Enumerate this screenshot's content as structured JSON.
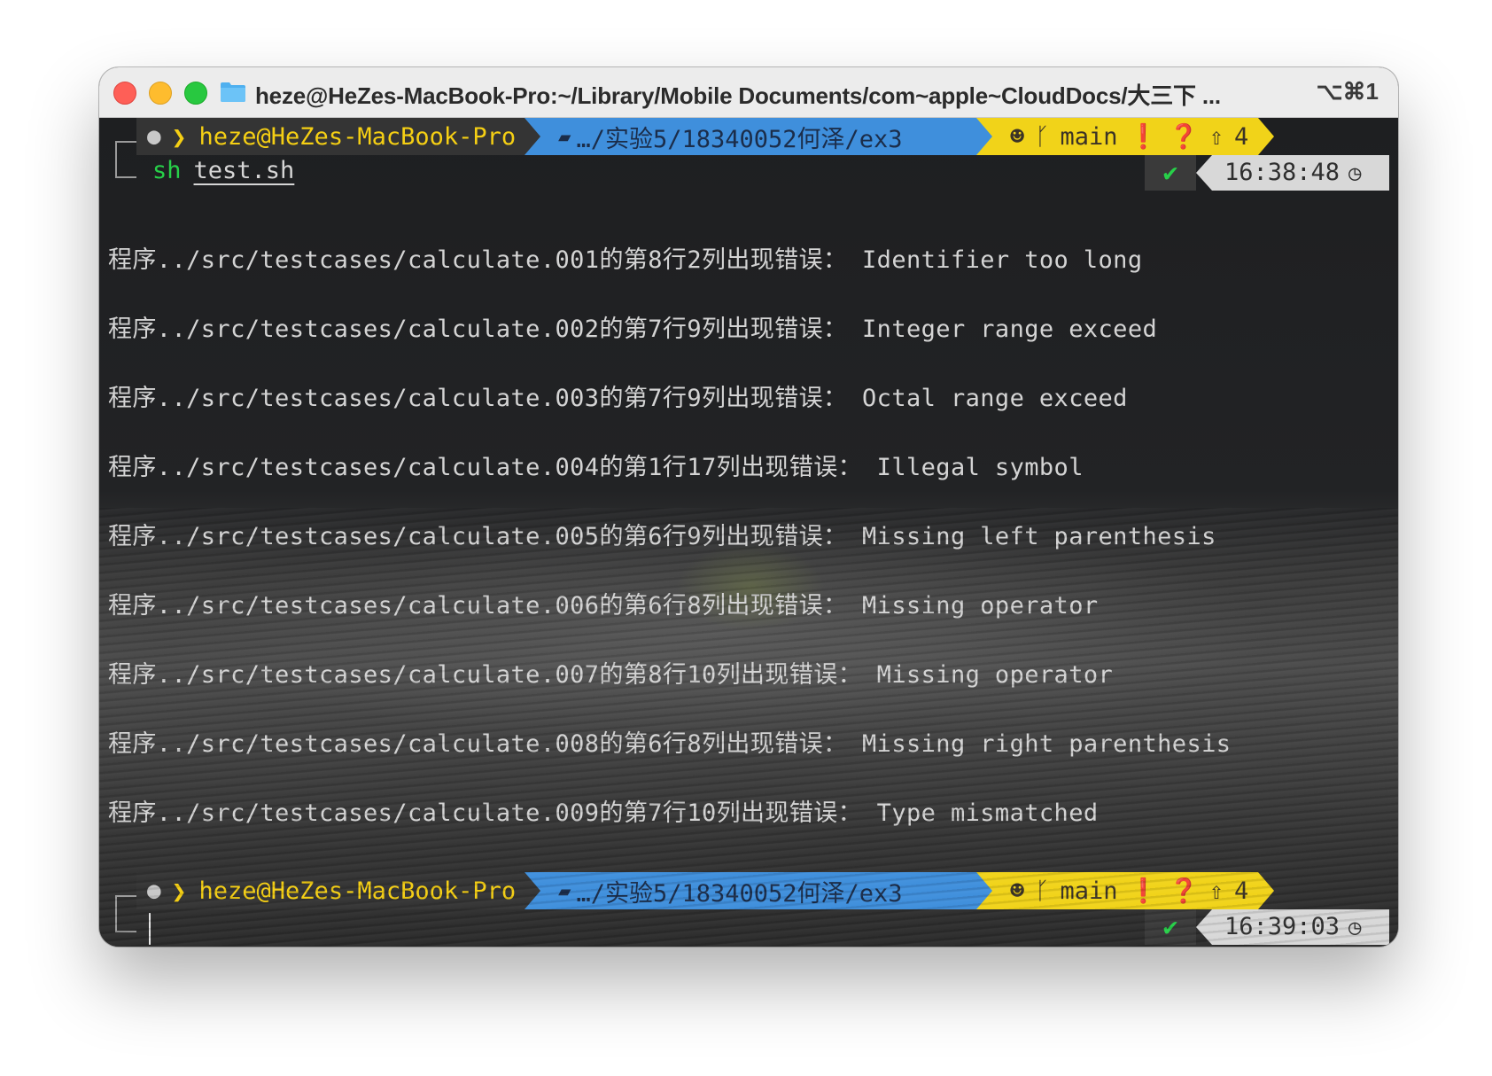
{
  "window": {
    "title": "heze@HeZes-MacBook-Pro:~/Library/Mobile Documents/com~apple~CloudDocs/大三下 ...",
    "shortcut": "⌥⌘1",
    "folder_icon": "folder-icon"
  },
  "prompts": [
    {
      "user_host": "heze@HeZes-MacBook-Pro",
      "dir": "…/实验5/18340052何泽/ex3",
      "branch": "main",
      "ahead_count": "4",
      "command": "sh",
      "argument": "test.sh",
      "time": "16:38:48"
    },
    {
      "user_host": "heze@HeZes-MacBook-Pro",
      "dir": "…/实验5/18340052何泽/ex3",
      "branch": "main",
      "ahead_count": "4",
      "time": "16:39:03"
    }
  ],
  "output_lines": [
    "程序../src/testcases/calculate.001的第8行2列出现错误： Identifier too long",
    "程序../src/testcases/calculate.002的第7行9列出现错误： Integer range exceed",
    "程序../src/testcases/calculate.003的第7行9列出现错误： Octal range exceed",
    "程序../src/testcases/calculate.004的第1行17列出现错误： Illegal symbol",
    "程序../src/testcases/calculate.005的第6行9列出现错误： Missing left parenthesis",
    "程序../src/testcases/calculate.006的第6行8列出现错误： Missing operator",
    "程序../src/testcases/calculate.007的第8行10列出现错误： Missing operator",
    "程序../src/testcases/calculate.008的第6行8列出现错误： Missing right parenthesis",
    "程序../src/testcases/calculate.009的第7行10列出现错误： Type mismatched"
  ],
  "colors": {
    "user_segment_bg": "#343434",
    "user_text": "#f5cf14",
    "dir_segment_bg": "#3f8fdc",
    "git_segment_bg": "#f1d319",
    "command_green": "#27d049",
    "output_text": "#d4d4d4"
  },
  "icons": {
    "apple": "apple-icon",
    "chevron": "chevron-right-icon",
    "dir": "folder-open-icon",
    "github": "github-cat-icon",
    "branch": "git-branch-icon",
    "warning": "exclamation-circle-icon",
    "question": "question-circle-icon",
    "ahead": "arrow-up-circle-icon",
    "check": "check-icon",
    "clock": "clock-icon"
  }
}
